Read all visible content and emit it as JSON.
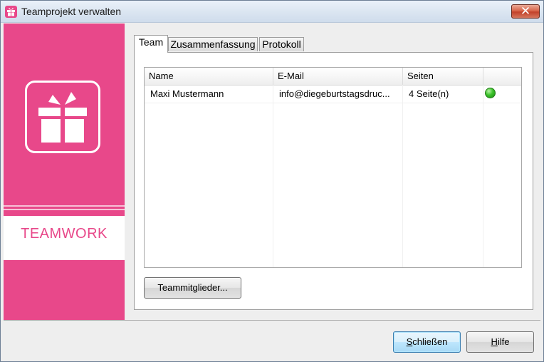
{
  "window": {
    "title": "Teamprojekt verwalten",
    "close_glyph": "✕",
    "app_icon": "gift-icon"
  },
  "sidebar": {
    "background": "#e8488a",
    "logo_icon": "gift-icon",
    "brand_text": "TEAMWORK"
  },
  "tabs": [
    {
      "label": "Team",
      "active": true
    },
    {
      "label": "Zusammenfassung",
      "active": false
    },
    {
      "label": "Protokoll",
      "active": false
    }
  ],
  "table": {
    "columns": [
      "Name",
      "E-Mail",
      "Seiten",
      ""
    ],
    "rows": [
      {
        "name": "Maxi Mustermann",
        "email": "info@diegeburtstagsdruc...",
        "pages": "4 Seite(n)",
        "status": "green"
      }
    ]
  },
  "buttons": {
    "members": "Teammitglieder...",
    "close": "Schließen",
    "help": "Hilfe"
  }
}
